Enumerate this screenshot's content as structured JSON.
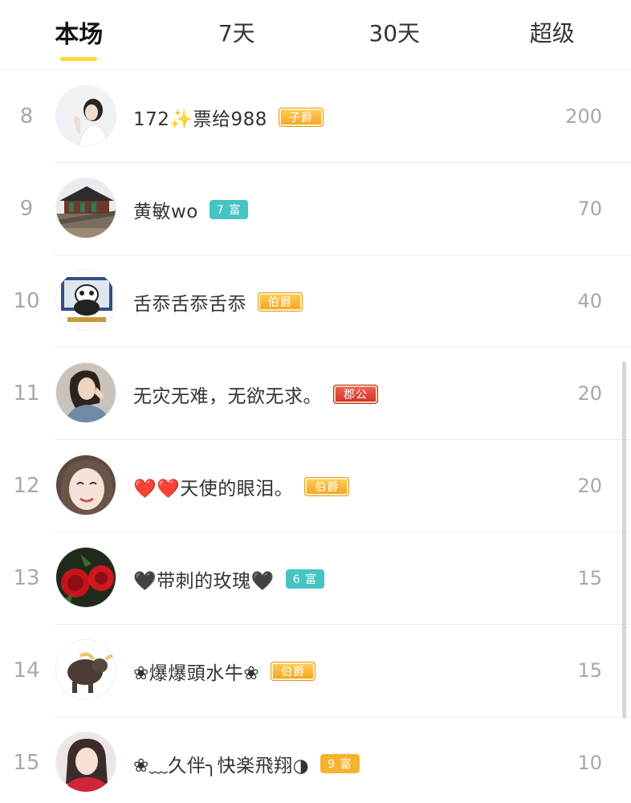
{
  "tabs": [
    {
      "label": "本场",
      "active": true
    },
    {
      "label": "7天",
      "active": false
    },
    {
      "label": "30天",
      "active": false
    },
    {
      "label": "超级",
      "active": false
    }
  ],
  "rows": [
    {
      "rank": "8",
      "name": "172✨票给988",
      "badge": "子爵",
      "badge_style": "gold",
      "score": "200",
      "avatar": "woman-white-background"
    },
    {
      "rank": "9",
      "name": "黄敏wo",
      "badge": "7 富",
      "badge_style": "teal",
      "score": "70",
      "avatar": "chinese-pavilion"
    },
    {
      "rank": "10",
      "name": "舌忝舌忝舌忝",
      "badge": "伯爵",
      "badge_style": "gold",
      "score": "40",
      "avatar": "panda-meme"
    },
    {
      "rank": "11",
      "name": "无灾无难，无欲无求。",
      "badge": "郡公",
      "badge_style": "red",
      "score": "20",
      "avatar": "woman-dark-hair"
    },
    {
      "rank": "12",
      "name": "❤️❤️天使的眼泪。",
      "badge": "伯爵",
      "badge_style": "gold",
      "score": "20",
      "avatar": "woman-face-closeup"
    },
    {
      "rank": "13",
      "name": "🖤带刺的玫瑰🖤",
      "badge": "6 富",
      "badge_style": "teal",
      "score": "15",
      "avatar": "red-roses"
    },
    {
      "rank": "14",
      "name": "❀爆爆頭水牛❀",
      "badge": "伯爵",
      "badge_style": "gold",
      "score": "15",
      "avatar": "cartoon-bull"
    },
    {
      "rank": "15",
      "name": "❀﹏久伴╮快楽飛翔◑",
      "badge": "9 富",
      "badge_style": "orange",
      "score": "10",
      "avatar": "woman-red-top"
    }
  ],
  "colors": {
    "tab_indicator": "#ffd83b",
    "rank_text": "#a8a8a8",
    "badge_gold": "#f4a41e",
    "badge_red": "#cf2f25",
    "badge_teal": "#45c4c4",
    "badge_orange": "#f6b332"
  }
}
